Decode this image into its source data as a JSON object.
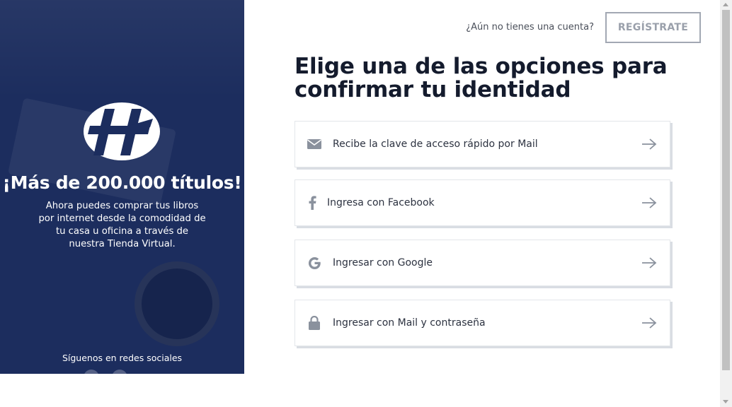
{
  "left_panel": {
    "headline": "¡Más de 200.000 títulos!",
    "description": "Ahora puedes comprar tus libros por internet desde la comodidad de tu casa u oficina a través de nuestra Tienda Virtual.",
    "social_label": "Síguenos en redes sociales",
    "background_color": "#1c2d5e"
  },
  "header": {
    "account_question": "¿Aún no tienes una cuenta?",
    "register_label": "REGÍSTRATE"
  },
  "main": {
    "title": "Elige una de las opciones para confirmar tu identidad",
    "options": [
      {
        "label": "Recibe la clave de acceso rápido por Mail",
        "icon": "mail-icon"
      },
      {
        "label": "Ingresa con Facebook",
        "icon": "facebook-icon"
      },
      {
        "label": "Ingresar con Google",
        "icon": "google-icon"
      },
      {
        "label": "Ingresar con Mail y contraseña",
        "icon": "lock-icon"
      }
    ]
  },
  "colors": {
    "icon_gray": "#8a919d",
    "title_dark": "#141b2d"
  }
}
